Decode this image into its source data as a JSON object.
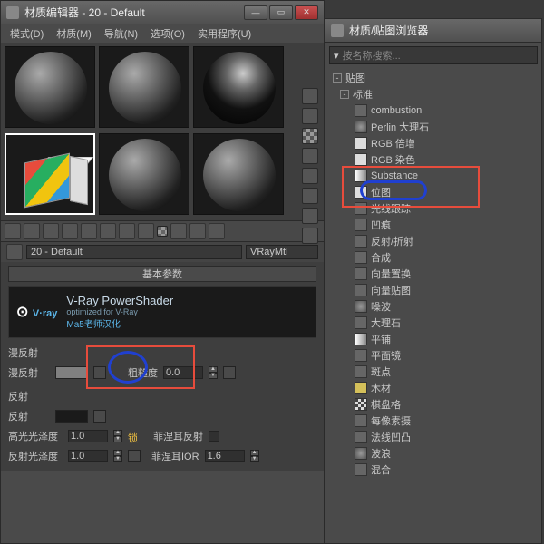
{
  "left_window": {
    "title": "材质编辑器 - 20 - Default",
    "menu": [
      "模式(D)",
      "材质(M)",
      "导航(N)",
      "选项(O)",
      "实用程序(U)"
    ],
    "material_name": "20 - Default",
    "material_type": "VRayMtl",
    "basic_params": "基本参数",
    "vray": {
      "brand": "V·ray",
      "title": "V-Ray PowerShader",
      "sub": "optimized for V-Ray",
      "cn": "Ma5老师汉化"
    },
    "diffuse": {
      "label": "漫反射",
      "sublabel": "漫反射",
      "rough_label": "粗糙度",
      "rough_val": "0.0"
    },
    "reflect": {
      "label": "反射",
      "sublabel": "反射",
      "gloss_label": "高光光泽度",
      "gloss_val": "1.0",
      "lock": "锁",
      "fresnel": "菲涅耳反射",
      "refl_gloss_label": "反射光泽度",
      "refl_gloss_val": "1.0",
      "fresnel_ior": "菲涅耳IOR",
      "ior_val": "1.6"
    }
  },
  "right_window": {
    "title": "材质/贴图浏览器",
    "search_placeholder": "按名称搜索...",
    "tree": {
      "root": "贴图",
      "std": "标准",
      "items": [
        "combustion",
        "Perlin 大理石",
        "RGB 倍增",
        "RGB 染色",
        "Substance",
        "位图",
        "光线跟踪",
        "凹痕",
        "反射/折射",
        "合成",
        "向量置换",
        "向量贴图",
        "噪波",
        "大理石",
        "平铺",
        "平面镜",
        "斑点",
        "木材",
        "棋盘格",
        "每像素摄",
        "法线凹凸",
        "波浪",
        "混合"
      ]
    }
  }
}
